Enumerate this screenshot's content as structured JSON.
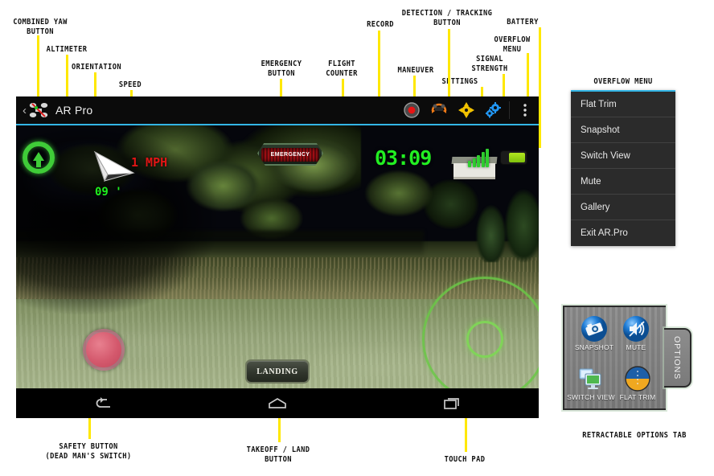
{
  "annotations": {
    "combined_yaw": "COMBINED YAW\nBUTTON",
    "altimeter": "ALTIMETER",
    "orientation": "ORIENTATION",
    "speed": "SPEED",
    "emergency": "EMERGENCY\nBUTTON",
    "flight_counter": "FLIGHT\nCOUNTER",
    "record": "RECORD",
    "maneuver": "MANEUVER",
    "detection_tracking": "DETECTION / TRACKING\nBUTTON",
    "settings": "SETTINGS",
    "signal_strength": "SIGNAL\nSTRENGTH",
    "overflow_menu": "OVERFLOW\nMENU",
    "battery": "BATTERY",
    "safety_button": "SAFETY BUTTON\n(DEAD MAN'S SWITCH)",
    "takeoff_land": "TAKEOFF / LAND\nBUTTON",
    "touch_pad": "TOUCH PAD",
    "overflow_menu_caption": "OVERFLOW MENU",
    "retractable_options_caption": "RETRACTABLE OPTIONS TAB"
  },
  "app": {
    "title": "AR Pro",
    "back_label": "‹",
    "toolbar_icons": [
      {
        "name": "record-icon",
        "label": "Record"
      },
      {
        "name": "maneuver-icon",
        "label": "Maneuver"
      },
      {
        "name": "detection-tracking-icon",
        "label": "Detection / Tracking"
      },
      {
        "name": "settings-icon",
        "label": "Settings"
      },
      {
        "name": "overflow-menu-icon",
        "label": "Overflow menu"
      }
    ]
  },
  "hud": {
    "speed": "1 MPH",
    "altitude": "09 '",
    "flight_counter": "03:09",
    "emergency_label": "EMERGENCY",
    "landing_label": "LANDING",
    "signal_bars": 5,
    "battery_level": "full",
    "colors": {
      "accent": "#33b5e5",
      "altitude_green": "#1ef01e",
      "counter_green": "#22ef22",
      "speed_red": "#e01515",
      "yaw_green": "#3fcc38",
      "touchpad_green": "#6ac846",
      "safety_pink": "#d4596d",
      "battery_green": "#8fd414"
    }
  },
  "navbar": {
    "items": [
      {
        "name": "nav-back",
        "label": "Back"
      },
      {
        "name": "nav-home",
        "label": "Home"
      },
      {
        "name": "nav-recents",
        "label": "Recent apps"
      }
    ]
  },
  "overflow_menu": {
    "items": [
      "Flat Trim",
      "Snapshot",
      "Switch View",
      "Mute",
      "Gallery",
      "Exit AR.Pro"
    ]
  },
  "options_tab": {
    "handle_label": "OPTIONS",
    "items": [
      {
        "label": "SNAPSHOT",
        "icon": "camera-icon"
      },
      {
        "label": "MUTE",
        "icon": "speaker-mute-icon"
      },
      {
        "label": "SWITCH VIEW",
        "icon": "monitors-icon"
      },
      {
        "label": "FLAT TRIM",
        "icon": "horizon-icon"
      }
    ]
  }
}
